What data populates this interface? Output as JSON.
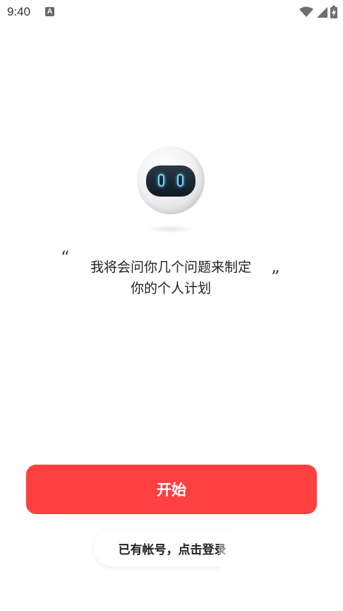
{
  "status_bar": {
    "time": "9:40",
    "notification_icon_letter": "A",
    "icons": [
      "wifi-icon",
      "cellular-signal-icon",
      "battery-charging-icon"
    ]
  },
  "intro": {
    "quote_open": "“",
    "quote_close": "”",
    "line1": "我将会问你几个问题来制定",
    "line2": "你的个人计划"
  },
  "start_button": {
    "label": "开始",
    "color": "#ff4040"
  },
  "login_link": {
    "label": "已有帐号，点击登录"
  }
}
